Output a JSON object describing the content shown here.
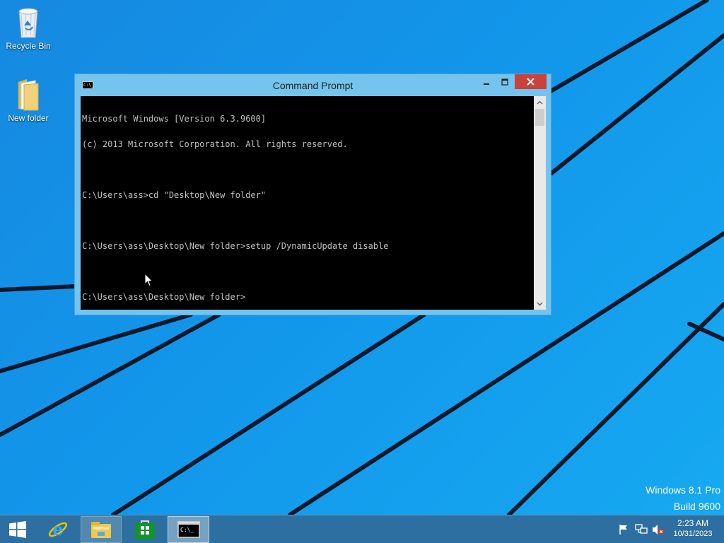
{
  "desktop": {
    "icons": [
      {
        "label": "Recycle Bin",
        "icon": "recycle-bin-icon"
      },
      {
        "label": "New folder",
        "icon": "folder-icon"
      }
    ],
    "watermark": {
      "edition": "Windows 8.1 Pro",
      "build": "Build 9600"
    }
  },
  "window": {
    "title": "Command Prompt",
    "icon": "command-prompt-icon",
    "title_icon_text": "C:\\_",
    "controls": {
      "minimize": "minimize-icon",
      "maximize": "maximize-icon",
      "close": "close-icon"
    },
    "console_lines": [
      "Microsoft Windows [Version 6.3.9600]",
      "(c) 2013 Microsoft Corporation. All rights reserved.",
      "",
      "C:\\Users\\ass>cd \"Desktop\\New folder\"",
      "",
      "C:\\Users\\ass\\Desktop\\New folder>setup /DynamicUpdate disable",
      "",
      "C:\\Users\\ass\\Desktop\\New folder>"
    ]
  },
  "taskbar": {
    "items": [
      {
        "name": "start",
        "icon": "windows-logo-icon"
      },
      {
        "name": "internet-explorer",
        "icon": "internet-explorer-icon"
      },
      {
        "name": "file-explorer",
        "icon": "file-explorer-icon"
      },
      {
        "name": "store",
        "icon": "store-icon"
      },
      {
        "name": "command-prompt",
        "icon": "command-prompt-icon",
        "icon_text": "C:\\_"
      }
    ],
    "tray": {
      "icons": [
        "action-center-flag-icon",
        "network-icon",
        "volume-muted-icon"
      ],
      "time": "2:23 AM",
      "date": "10/31/2023"
    }
  },
  "colors": {
    "desktop_blue": "#1296ea",
    "window_frame": "#74c4ee",
    "close_button": "#c9423b",
    "taskbar": "#2d6fa0",
    "console_bg": "#000000",
    "console_text": "#c0c0c0"
  }
}
